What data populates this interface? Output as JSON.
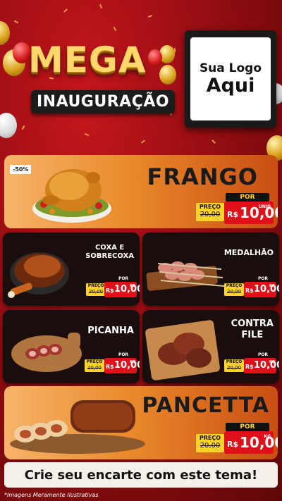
{
  "header": {
    "title_main": "MEGA",
    "title_sub": "INAUGURAÇÃO",
    "logo_line1": "Sua Logo",
    "logo_line2": "Aqui"
  },
  "products": [
    {
      "name": "FRANGO",
      "badge": "-50%",
      "preco_label": "PREÇO",
      "old_price": "20,00",
      "por_label": "POR",
      "currency": "R$",
      "price": "10,00",
      "unit": "UNID"
    },
    {
      "name": "COXA E\nSOBRECOXA",
      "preco_label": "PREÇO",
      "old_price": "20,00",
      "por_label": "POR",
      "currency": "R$",
      "price": "10,00",
      "unit": "KG"
    },
    {
      "name": "MEDALHÃO",
      "preco_label": "PREÇO",
      "old_price": "20,00",
      "por_label": "POR",
      "currency": "R$",
      "price": "10,00",
      "unit": "KG"
    },
    {
      "name": "PICANHA",
      "preco_label": "PREÇO",
      "old_price": "20,00",
      "por_label": "POR",
      "currency": "R$",
      "price": "10,00",
      "unit": "KG"
    },
    {
      "name": "CONTRA\nFILE",
      "preco_label": "PREÇO",
      "old_price": "20,00",
      "por_label": "POR",
      "currency": "R$",
      "price": "10,00",
      "unit": "KG"
    },
    {
      "name": "PANCETTA",
      "preco_label": "PREÇO",
      "old_price": "20,00",
      "por_label": "POR",
      "currency": "R$",
      "price": "10,00",
      "unit": "KG"
    }
  ],
  "footer": {
    "cta": "Crie seu encarte com este tema!",
    "note": "*Imagens Meramente Ilustrativas"
  },
  "colors": {
    "accent_red": "#e0101a",
    "accent_yellow": "#ffd22d",
    "bg_red": "#a80f14"
  }
}
